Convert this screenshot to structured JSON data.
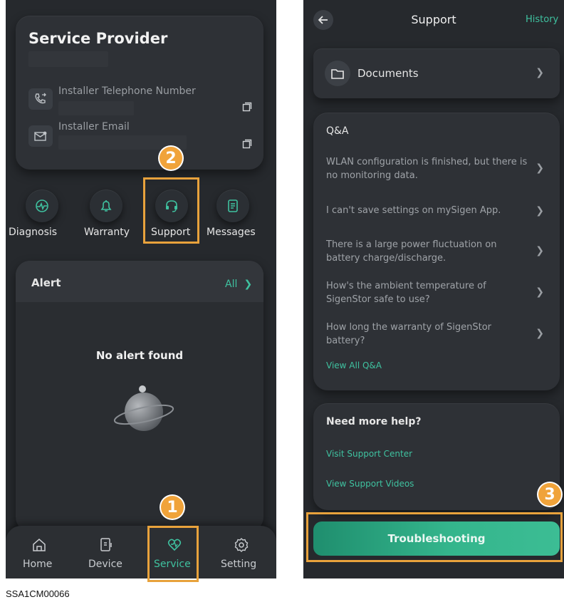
{
  "left": {
    "provider": {
      "title": "Service Provider",
      "phone_label": "Installer Telephone Number",
      "email_label": "Installer Email"
    },
    "services": [
      {
        "label": "Diagnosis",
        "icon": "diagnosis-icon"
      },
      {
        "label": "Warranty",
        "icon": "bell-icon"
      },
      {
        "label": "Support",
        "icon": "headset-icon"
      },
      {
        "label": "Messages",
        "icon": "messages-icon"
      }
    ],
    "alert": {
      "title": "Alert",
      "all_link": "All",
      "empty_text": "No alert found"
    },
    "nav": [
      {
        "label": "Home",
        "icon": "home-icon"
      },
      {
        "label": "Device",
        "icon": "device-icon"
      },
      {
        "label": "Service",
        "icon": "service-icon"
      },
      {
        "label": "Setting",
        "icon": "gear-icon"
      }
    ],
    "badges": {
      "one": "1",
      "two": "2"
    }
  },
  "right": {
    "header": {
      "title": "Support",
      "history_link": "History"
    },
    "documents_label": "Documents",
    "qa": {
      "title": "Q&A",
      "items": [
        "WLAN configuration is finished, but there is no monitoring data.",
        "I can't save settings on mySigen App.",
        "There is a large power fluctuation on battery charge/discharge.",
        "How's the ambient temperature of SigenStor safe to use?",
        "How long the warranty of SigenStor battery?"
      ],
      "view_all": "View All Q&A"
    },
    "help": {
      "title": "Need more help?",
      "visit_center": "Visit Support Center",
      "view_videos": "View Support Videos"
    },
    "troubleshooting_label": "Troubleshooting",
    "badge_three": "3"
  },
  "caption": "SSA1CM00066",
  "colors": {
    "accent": "#3fc2a0",
    "highlight": "#e8a23c",
    "background": "#26292d"
  }
}
